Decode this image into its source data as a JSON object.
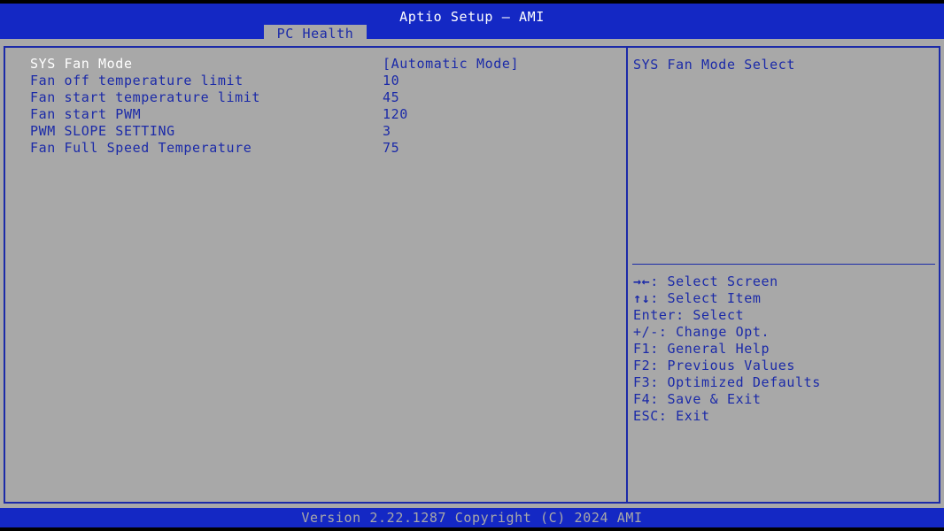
{
  "title_bar": {
    "title": "Aptio Setup – AMI"
  },
  "tabs": [
    {
      "label": "PC Health"
    }
  ],
  "settings": [
    {
      "label": "SYS Fan Mode",
      "value": "[Automatic Mode]"
    },
    {
      "label": "Fan off temperature limit",
      "value": "10"
    },
    {
      "label": "Fan start temperature limit",
      "value": "45"
    },
    {
      "label": "Fan start PWM",
      "value": "120"
    },
    {
      "label": "PWM SLOPE SETTING",
      "value": "3"
    },
    {
      "label": "Fan Full Speed Temperature",
      "value": "75"
    }
  ],
  "help": {
    "text": "SYS Fan Mode Select"
  },
  "key_help": [
    {
      "key": "→←",
      "desc": ": Select Screen"
    },
    {
      "key": "↑↓",
      "desc": ": Select Item"
    },
    {
      "key": "Enter",
      "desc": ": Select"
    },
    {
      "key": "+/-",
      "desc": ": Change Opt."
    },
    {
      "key": "F1",
      "desc": ": General Help"
    },
    {
      "key": "F2",
      "desc": ": Previous Values"
    },
    {
      "key": "F3",
      "desc": ": Optimized Defaults"
    },
    {
      "key": "F4",
      "desc": ": Save & Exit"
    },
    {
      "key": "ESC",
      "desc": ": Exit"
    }
  ],
  "footer": {
    "text": "Version 2.22.1287 Copyright (C) 2024 AMI"
  },
  "colors": {
    "bar_blue": "#1428c4",
    "panel_gray": "#a8a8a8",
    "text_blue": "#1b2aa8",
    "highlight_white": "#ffffff"
  }
}
